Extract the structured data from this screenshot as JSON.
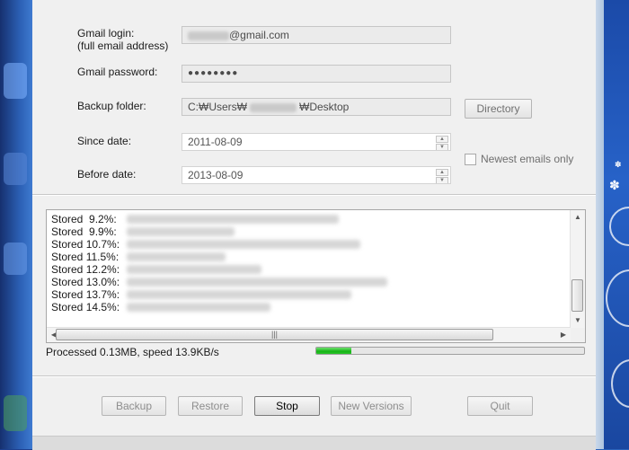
{
  "form": {
    "login_label_line1": "Gmail login:",
    "login_label_line2": "(full email address)",
    "login_value": "@gmail.com",
    "password_label": "Gmail password:",
    "password_value": "●●●●●●●●",
    "folder_label": "Backup folder:",
    "folder_prefix": "C:₩Users₩",
    "folder_suffix": "₩Desktop",
    "directory_button": "Directory",
    "since_label": "Since date:",
    "since_value": "2011-08-09",
    "before_label": "Before date:",
    "before_value": "2013-08-09",
    "newest_only_label": "Newest emails only"
  },
  "log": {
    "lines": [
      "Stored  9.2%:",
      "Stored  9.9%:",
      "Stored 10.7%:",
      "Stored 11.5%:",
      "Stored 12.2%:",
      "Stored 13.0%:",
      "Stored 13.7%:",
      "Stored 14.5%:"
    ]
  },
  "status": {
    "text": "Processed 0.13MB, speed 13.9KB/s",
    "progress_fraction": 0.13
  },
  "buttons": {
    "backup": "Backup",
    "restore": "Restore",
    "stop": "Stop",
    "new_versions": "New Versions",
    "quit": "Quit"
  },
  "colors": {
    "progress": "#17b417",
    "window_bg": "#f0f0f0"
  }
}
